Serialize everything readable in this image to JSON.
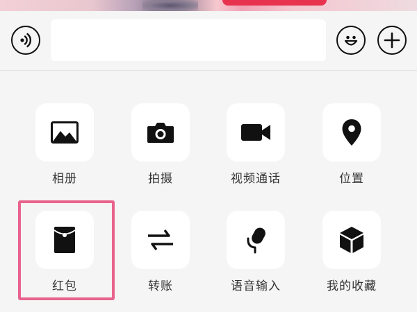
{
  "colors": {
    "background": "#f5f5f5",
    "tile": "#ffffff",
    "icon": "#111111",
    "label": "#333333",
    "highlight": "#e8638e"
  },
  "input_bar": {
    "voice_icon": "voice-wave-icon",
    "text_value": "",
    "emoji_icon": "smiley-face-icon",
    "plus_icon": "plus-circle-icon"
  },
  "panel": {
    "items": [
      {
        "label": "相册",
        "icon": "image-icon"
      },
      {
        "label": "拍摄",
        "icon": "camera-icon"
      },
      {
        "label": "视频通话",
        "icon": "video-camera-icon"
      },
      {
        "label": "位置",
        "icon": "location-pin-icon"
      },
      {
        "label": "红包",
        "icon": "red-packet-icon"
      },
      {
        "label": "转账",
        "icon": "transfer-icon"
      },
      {
        "label": "语音输入",
        "icon": "microphone-icon"
      },
      {
        "label": "我的收藏",
        "icon": "cube-icon"
      }
    ],
    "highlighted_item": "红包"
  }
}
